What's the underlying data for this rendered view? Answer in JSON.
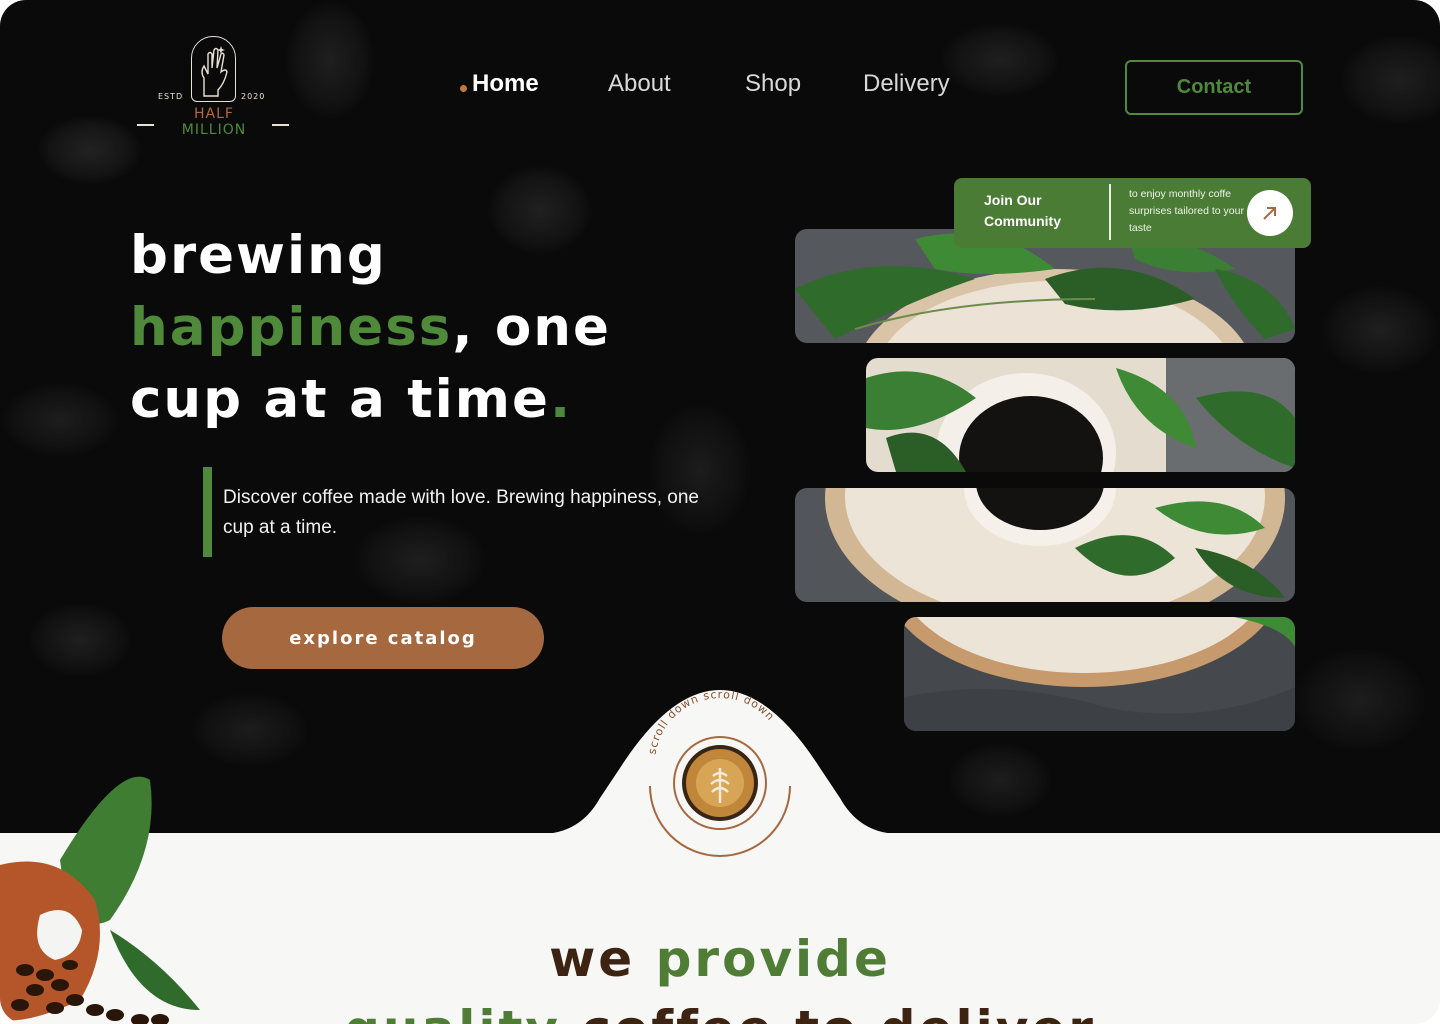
{
  "brand": {
    "estd": "ESTD",
    "year": "2020",
    "line1": "HALF",
    "line2": "MILLION"
  },
  "nav": {
    "items": [
      {
        "label": "Home",
        "active": true
      },
      {
        "label": "About",
        "active": false
      },
      {
        "label": "Shop",
        "active": false
      },
      {
        "label": "Delivery",
        "active": false
      }
    ],
    "contact_label": "Contact"
  },
  "hero": {
    "headline": {
      "line1": "Brewing",
      "line2_green": "Happiness",
      "line2_rest": ", one",
      "line3": "cup at a time",
      "line3_dot": "."
    },
    "description": "Discover coffee made with love. Brewing happiness, one cup at a time.",
    "cta_label": "Explore Catalog"
  },
  "community": {
    "title": "Join Our Community",
    "note": "to enjoy monthly coffe surprises tailored to your taste",
    "icon": "arrow-up-right-icon"
  },
  "scroll": {
    "text": "scroll down scroll down"
  },
  "provide": {
    "we": "We",
    "provide": "Provide",
    "line2_green": "Quality",
    "line2_rest": "coffee to deliver"
  },
  "colors": {
    "green": "#4f8a3a",
    "brown": "#a5683f",
    "dark": "#0a0a0a",
    "light": "#f7f7f5"
  }
}
